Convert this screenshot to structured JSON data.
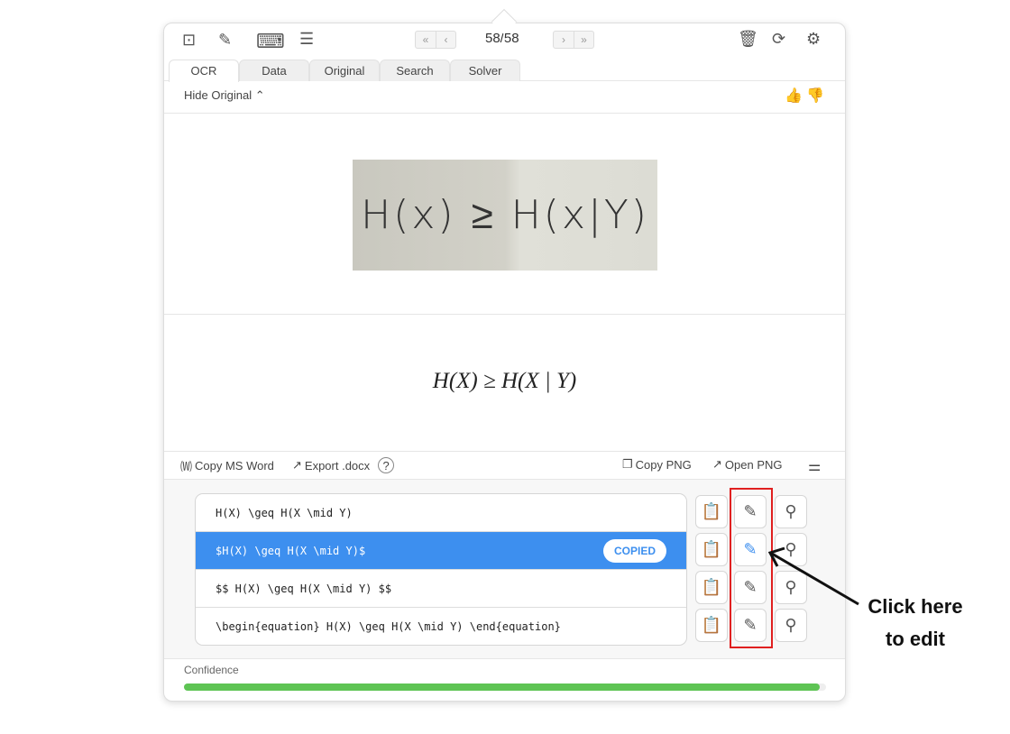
{
  "toolbar": {
    "icons": [
      "crop-screen-icon",
      "pen-icon",
      "keyboard-icon",
      "text-lines-icon"
    ],
    "counter": "58/58",
    "right_icons": [
      "trash-icon",
      "refresh-icon",
      "gear-icon"
    ]
  },
  "tabs": [
    {
      "label": "OCR",
      "active": true
    },
    {
      "label": "Data"
    },
    {
      "label": "Original"
    },
    {
      "label": "Search"
    },
    {
      "label": "Solver"
    }
  ],
  "hide_original": "Hide Original",
  "original_image_text": "H(x) ≥ H(x|Y)",
  "rendered_formula": "H(X) ≥ H(X | Y)",
  "actions": {
    "copy_word": "Copy MS Word",
    "export_docx": "Export .docx",
    "copy_png": "Copy PNG",
    "open_png": "Open PNG"
  },
  "results": [
    {
      "text": "H(X) \\geq H(X \\mid Y)"
    },
    {
      "text": "$H(X) \\geq H(X \\mid Y)$",
      "selected": true,
      "badge": "COPIED"
    },
    {
      "text": "$$ H(X) \\geq H(X \\mid Y) $$"
    },
    {
      "text": "\\begin{equation} H(X) \\geq H(X \\mid Y) \\end{equation}"
    }
  ],
  "confidence": {
    "label": "Confidence",
    "value": 0.99
  },
  "annotation": {
    "line1": "Click here",
    "line2": "to edit"
  },
  "colors": {
    "accent": "#3d8fef",
    "confidence": "#5ec454",
    "highlight": "#e02020"
  }
}
